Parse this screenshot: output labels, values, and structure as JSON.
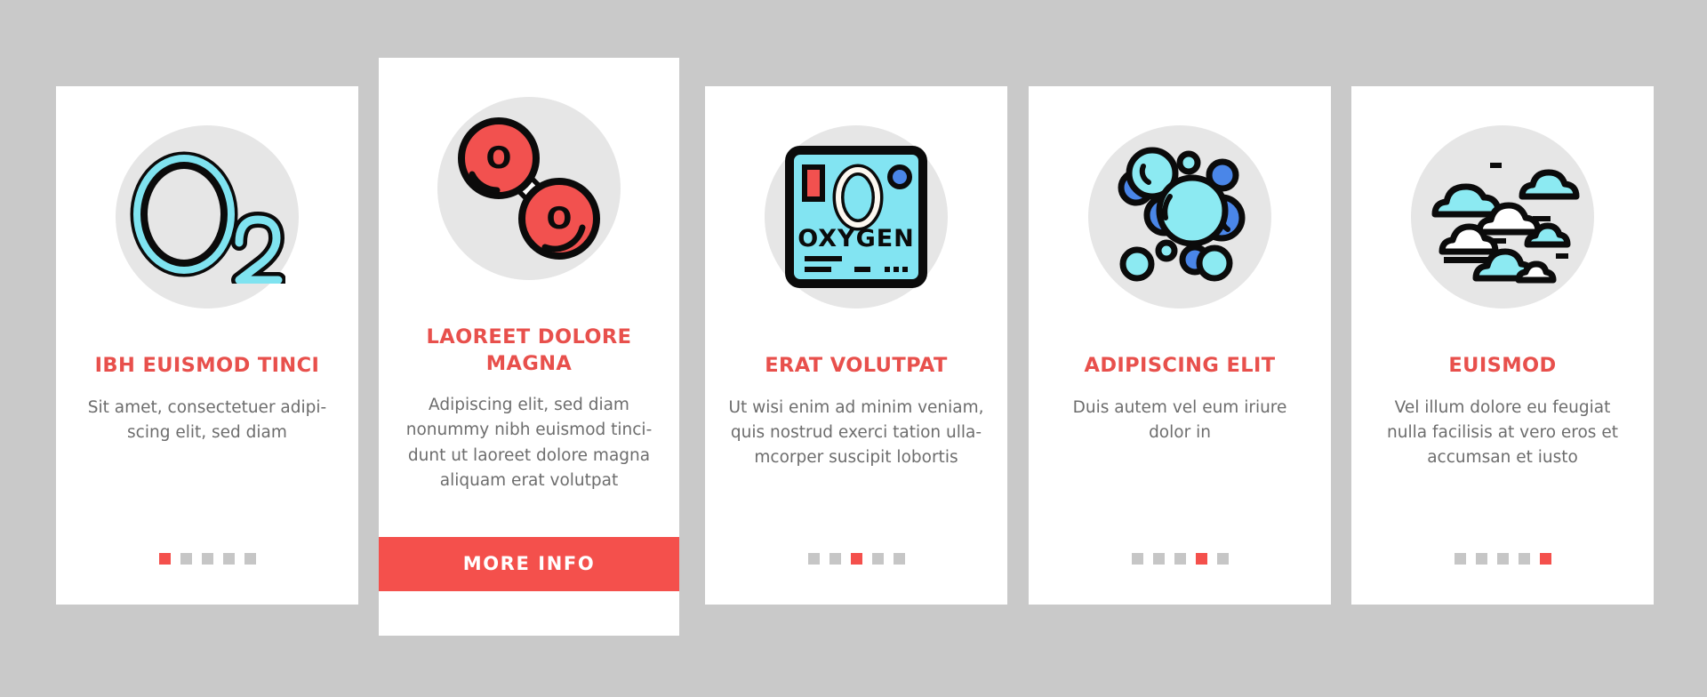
{
  "page": {
    "background_color": "#c9c9c9",
    "accent_color": "#f4504c",
    "title_color": "#e8504c",
    "body_text_color": "#6d6d6d",
    "icon_circle_color": "#e6e6e6"
  },
  "cards": [
    {
      "id": "card-1",
      "featured": false,
      "icon": "o2-formula-icon",
      "title": "IBH EUISMOD TINCI",
      "description": "Sit amet, consectetuer adipi-scing elit, sed diam",
      "description_lines": [
        "Sit amet, consectetuer adipi-",
        "scing elit, sed diam"
      ],
      "dots_total": 5,
      "dots_active_index": 1
    },
    {
      "id": "card-2",
      "featured": true,
      "icon": "oxygen-molecule-icon",
      "title": "LAOREET DOLORE MAGNA",
      "description": "Adipiscing elit, sed diam nonummy nibh euismod tincidunt ut laoreet dolore magna aliquam erat volutpat",
      "description_lines": [
        "Adipiscing elit, sed diam",
        "nonummy nibh euismod tinci-",
        "dunt ut laoreet dolore magna",
        "aliquam erat volutpat"
      ],
      "button_label": "MORE INFO"
    },
    {
      "id": "card-3",
      "featured": false,
      "icon": "oxygen-element-card-icon",
      "title": "ERAT VOLUTPAT",
      "description": "Ut wisi enim ad minim veniam, quis nostrud exerci tation ullamcorper suscipit lobortis",
      "description_lines": [
        "Ut wisi enim ad minim veniam,",
        "quis nostrud exerci tation ulla-",
        "mcorper suscipit lobortis"
      ],
      "dots_total": 5,
      "dots_active_index": 3
    },
    {
      "id": "card-4",
      "featured": false,
      "icon": "oxygen-bubbles-icon",
      "title": "ADIPISCING ELIT",
      "description": "Duis autem vel eum iriure dolor in",
      "description_lines": [
        "Duis autem vel eum iriure",
        "dolor in"
      ],
      "dots_total": 5,
      "dots_active_index": 4
    },
    {
      "id": "card-5",
      "featured": false,
      "icon": "clouds-icon",
      "title": "EUISMOD",
      "description": "Vel illum dolore eu feugiat nulla facilisis at vero eros et accumsan et iusto",
      "description_lines": [
        "Vel illum dolore eu feugiat",
        "nulla facilisis at vero eros et",
        "accumsan et iusto"
      ],
      "dots_total": 5,
      "dots_active_index": 5
    }
  ],
  "icon_labels": {
    "o2_symbol": "O",
    "o2_subscript": "2",
    "molecule_atom_label": "O",
    "element_card_letter": "O",
    "element_card_name": "OXYGEN"
  }
}
